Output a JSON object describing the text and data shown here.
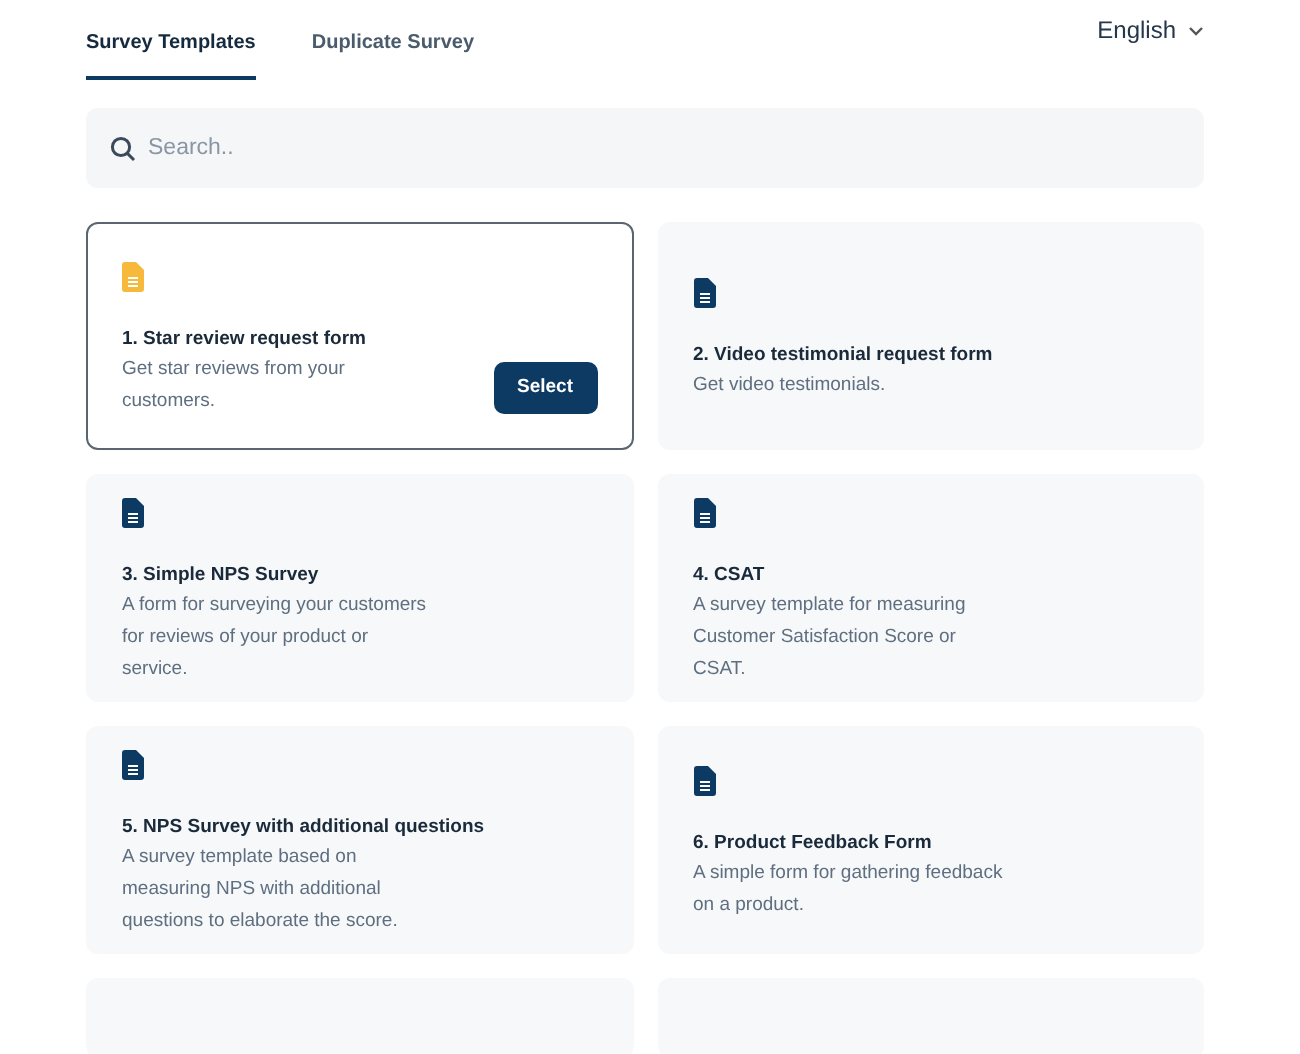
{
  "tabs": [
    {
      "label": "Survey Templates",
      "selected": true
    },
    {
      "label": "Duplicate Survey",
      "selected": false
    }
  ],
  "language": {
    "label": "English"
  },
  "search": {
    "placeholder": "Search.."
  },
  "select_label": "Select",
  "templates": [
    {
      "title": "1. Star review request form",
      "description": "Get star reviews from your customers.",
      "selected": true
    },
    {
      "title": "2. Video testimonial request form",
      "description": "Get video testimonials.",
      "selected": false
    },
    {
      "title": "3. Simple NPS Survey",
      "description": "A form for surveying your customers for reviews of your product or service.",
      "selected": false
    },
    {
      "title": "4. CSAT",
      "description": "A survey template for measuring Customer Satisfaction Score or CSAT.",
      "selected": false
    },
    {
      "title": "5. NPS Survey with additional questions",
      "description": "A survey template based on measuring NPS with additional questions to elaborate the score.",
      "selected": false
    },
    {
      "title": "6. Product Feedback Form",
      "description": "A simple form for gathering feedback on a product.",
      "selected": false
    }
  ]
}
